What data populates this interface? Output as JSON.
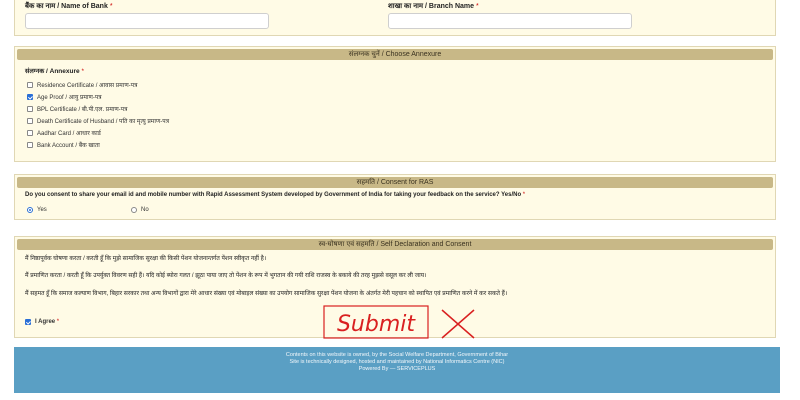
{
  "bank": {
    "name_label": "बैंक का नाम / Name of Bank",
    "branch_label": "शाखा का नाम / Branch Name",
    "required_mark": "*",
    "name_value": "",
    "branch_value": ""
  },
  "annexure": {
    "heading": "संलग्नक चुनें / Choose Annexure",
    "field_label": "संलग्नक / Annexure",
    "required_mark": "*",
    "options": [
      {
        "label": "Residence Certificate / आवास प्रमाण-पत्र",
        "checked": false
      },
      {
        "label": "Age Proof / आयु प्रमाण-पत्र",
        "checked": true
      },
      {
        "label": "BPL Certificate / बी.पी.एल. प्रमाण-पत्र",
        "checked": false
      },
      {
        "label": "Death Certificate of Husband / पति का मृत्यु प्रमाण-पत्र",
        "checked": false
      },
      {
        "label": "Aadhar Card / आधार कार्ड",
        "checked": false
      },
      {
        "label": "Bank Account / बैंक खाता",
        "checked": false
      }
    ]
  },
  "consent": {
    "heading": "सहमति / Consent for RAS",
    "question": "Do you consent to share your email id and mobile number with Rapid Assessment System developed by Government of India for taking your feedback on the service? Yes/No",
    "required_mark": "*",
    "options": [
      {
        "label": "Yes",
        "checked": true
      },
      {
        "label": "No",
        "checked": false
      }
    ]
  },
  "declaration": {
    "heading": "स्व-घोषणा एवं सहमति / Self Declaration and Consent",
    "lines": [
      "मैं निष्ठापूर्वक घोषणा करता / करती हूँ कि मुझे सामाजिक सुरक्षा की किसी पेंशन योजनान्तर्गत पेंशन स्वीकृत नहीं है।",
      "मैं प्रमाणित करता / करती हूँ कि उपर्युक्त विवरण सही हैं। यदि कोई ब्योरा गलत / झूठा पाया जाए तो पेंशन के रूप में भुगतान की गयी राशि राजस्व के बकाये की तरह मुझसे वसूल कर ली जाय।",
      "मैं सहमत हूँ कि समाज कल्याण विभाग, बिहार सरकार तथा अन्य विभागों द्वारा मेरे आधार संख्या एवं मोबाइल संख्या का उपयोग सामाजिक सुरक्षा पेंशन योजना के अंतर्गत मेरी पहचान को स्थापित एवं प्रमाणित करने में कर सकते हैं।"
    ],
    "agree_label": "I Agree",
    "agree_checked": true,
    "required_mark": "*"
  },
  "annotation": {
    "text": "Submit",
    "cross": "X",
    "color": "#d92020"
  },
  "footer": {
    "line1": "Contents on this website is owned, by the Social Welfare Department, Government of Bihar",
    "line2": "Site is technically designed, hosted and maintained by National Informatics Centre (NIC)",
    "line3": "Powered By — SERVICEPLUS",
    "bg_color": "#5a9fc4"
  }
}
